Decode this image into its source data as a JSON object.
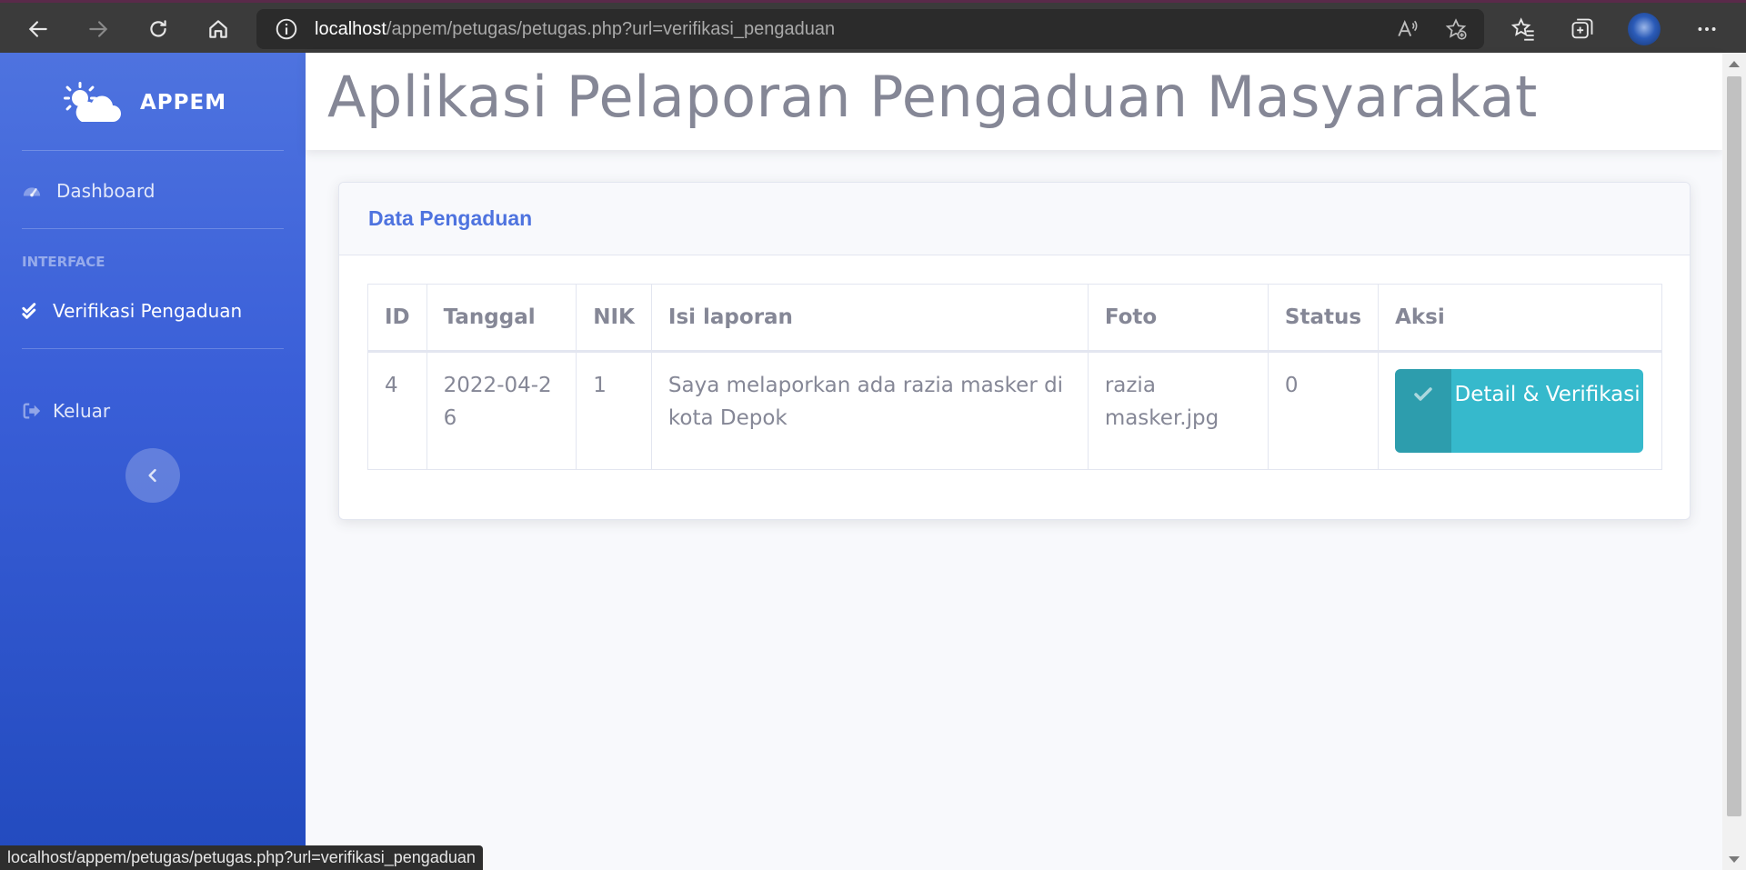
{
  "browser": {
    "url_host": "localhost",
    "url_path": "/appem/petugas/petugas.php?url=verifikasi_pengaduan"
  },
  "sidebar": {
    "brand": "APPEM",
    "items": [
      {
        "label": "Dashboard",
        "icon": "tachometer-icon"
      },
      {
        "label": "Verifikasi Pengaduan",
        "icon": "check-double-icon"
      },
      {
        "label": "Keluar",
        "icon": "sign-out-icon"
      }
    ],
    "heading": "INTERFACE"
  },
  "topbar": {
    "title": "Aplikasi Pelaporan Pengaduan Masyarakat"
  },
  "card": {
    "title": "Data Pengaduan",
    "columns": [
      "ID",
      "Tanggal",
      "NIK",
      "Isi laporan",
      "Foto",
      "Status",
      "Aksi"
    ],
    "rows": [
      {
        "id": "4",
        "tanggal": "2022-04-26",
        "nik": "1",
        "isi": "Saya melaporkan ada razia masker di kota Depok",
        "foto": "razia masker.jpg",
        "status": "0",
        "aksi": "Detail & Verifikasi"
      }
    ]
  },
  "statusbar": {
    "text": "localhost/appem/petugas/petugas.php?url=verifikasi_pengaduan"
  },
  "colors": {
    "primary": "#4e73df",
    "info": "#36b9cc",
    "text_muted": "#858796"
  }
}
